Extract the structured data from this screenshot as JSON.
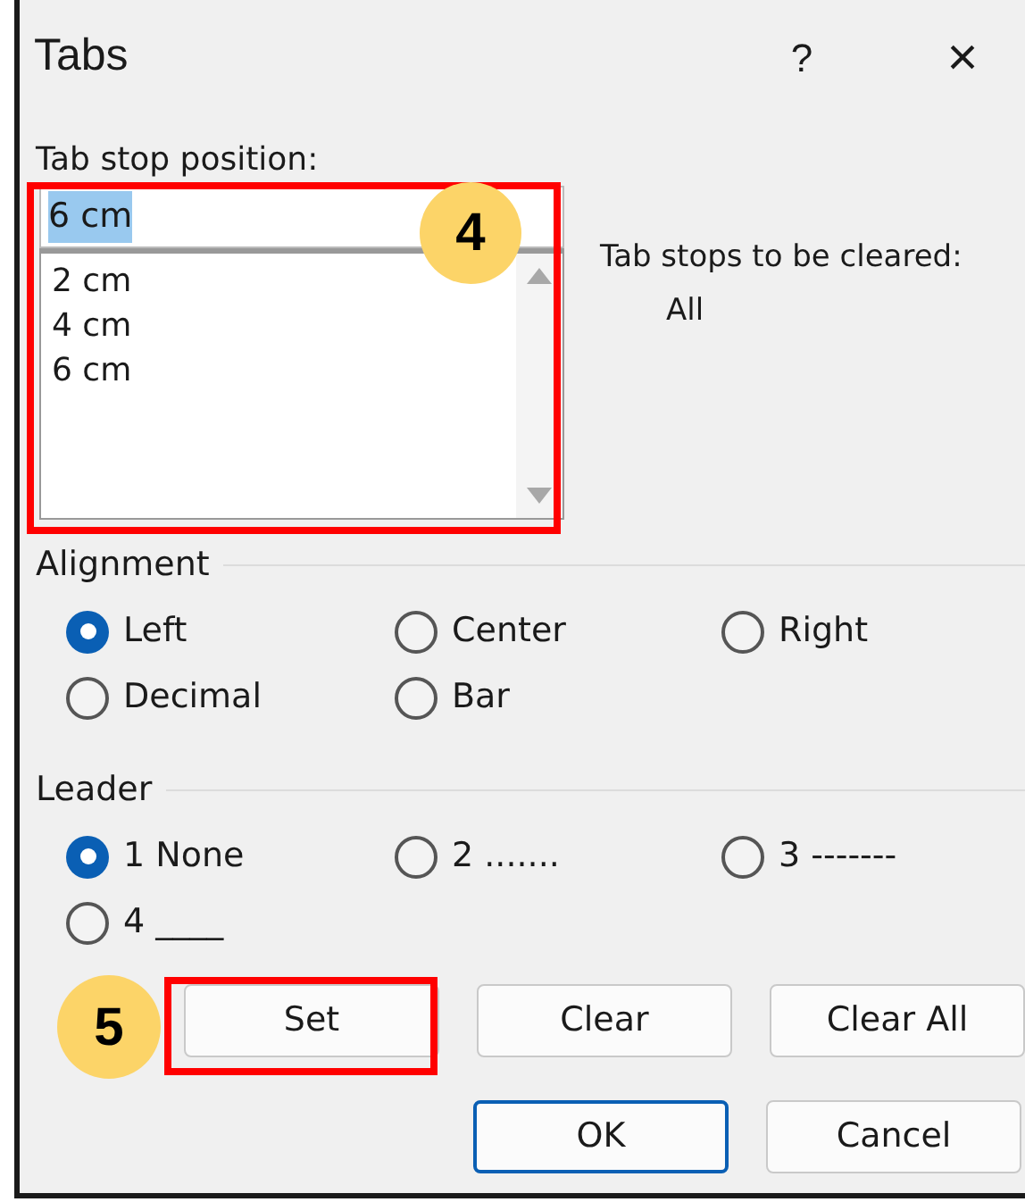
{
  "window": {
    "title": "Tabs",
    "help": "?",
    "close": "×"
  },
  "tab_stop_position": {
    "label": "Tab stop position:",
    "value": "6 cm",
    "value_selected": true,
    "list": [
      {
        "label": "2 cm"
      },
      {
        "label": "4 cm"
      },
      {
        "label": "6 cm"
      }
    ]
  },
  "to_be_cleared": {
    "label": "Tab stops to be cleared:",
    "value": "All"
  },
  "alignment": {
    "title": "Alignment",
    "options": [
      {
        "label": "Left",
        "selected": true
      },
      {
        "label": "Center",
        "selected": false
      },
      {
        "label": "Right",
        "selected": false
      },
      {
        "label": "Decimal",
        "selected": false
      },
      {
        "label": "Bar",
        "selected": false
      }
    ]
  },
  "leader": {
    "title": "Leader",
    "options": [
      {
        "label": "1 None",
        "selected": true
      },
      {
        "label": "2 .......",
        "selected": false
      },
      {
        "label": "3 -------",
        "selected": false
      },
      {
        "label": "4 ____",
        "selected": false
      }
    ]
  },
  "buttons": [
    {
      "label": "Set",
      "default": false
    },
    {
      "label": "Clear",
      "default": false
    },
    {
      "label": "Clear All",
      "default": false
    }
  ],
  "footer_buttons": [
    {
      "label": "OK",
      "default": true
    },
    {
      "label": "Cancel",
      "default": false
    }
  ],
  "callouts": [
    {
      "number": "4"
    },
    {
      "number": "5"
    }
  ]
}
